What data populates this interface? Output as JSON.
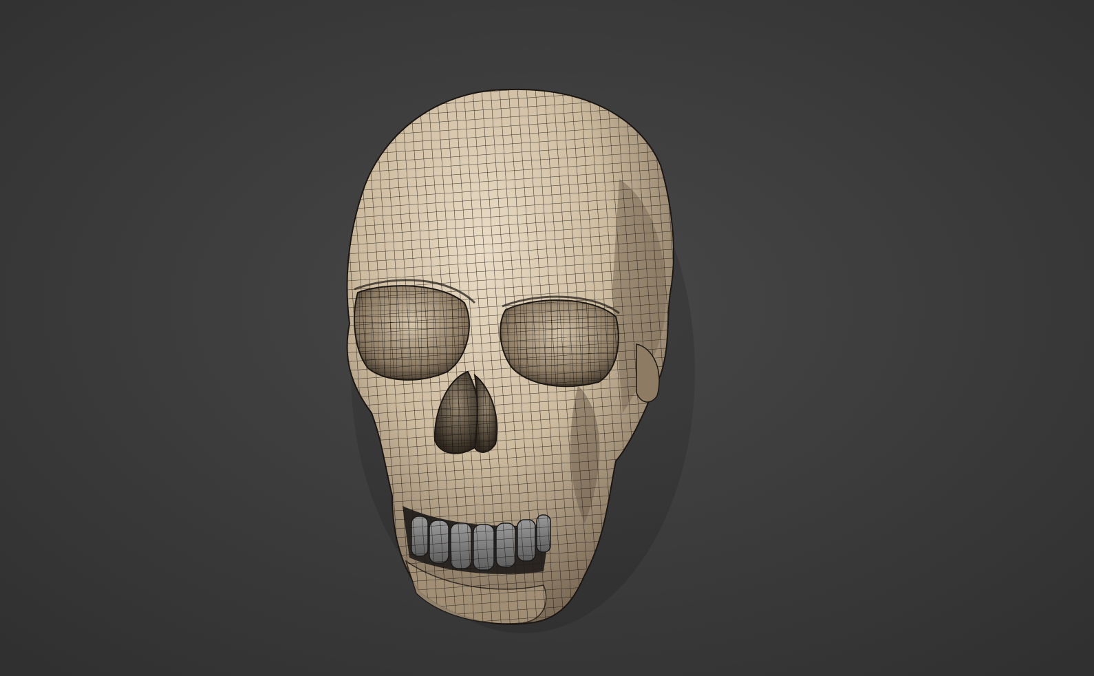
{
  "scene": {
    "subject": "skull-wireframe-render",
    "colors": {
      "background_center": "#474747",
      "background_edge": "#2e2e2e",
      "bone_light": "#e6d8c2",
      "bone_mid": "#c7b49a",
      "bone_shadow": "#6e5f4e",
      "wire": "#1a1612",
      "teeth": "#8a8a8a"
    }
  }
}
